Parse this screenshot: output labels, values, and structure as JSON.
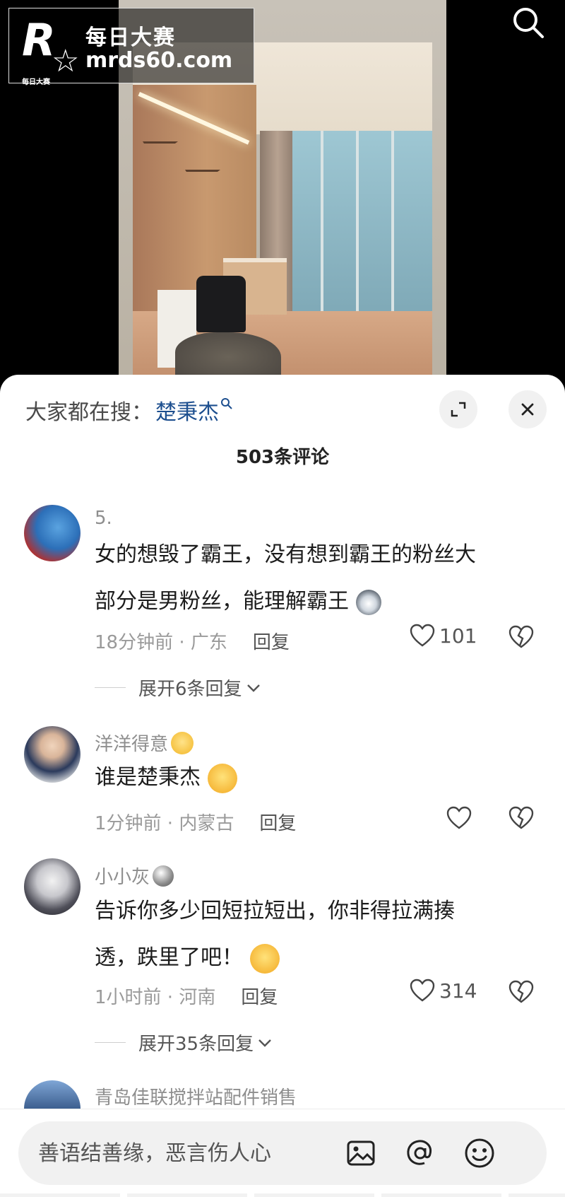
{
  "watermark": {
    "brand": "每日大赛",
    "url": "mrds60.com",
    "mark_letter": "R",
    "mark_mini": "每日大赛"
  },
  "sheet": {
    "hot_search_label": "大家都在搜：",
    "hot_search_term": "楚秉杰",
    "comment_count": "503条评论"
  },
  "comments": [
    {
      "name": "5.",
      "text_line1": "女的想毁了霸王，没有想到霸王的粉丝大",
      "text_line2": "部分是男粉丝，能理解霸王",
      "time_location": "18分钟前 · 广东",
      "reply_label": "回复",
      "likes": "101",
      "expand_label": "展开6条回复"
    },
    {
      "name": "洋洋得意",
      "text_line1": "谁是楚秉杰",
      "time_location": "1分钟前 · 内蒙古",
      "reply_label": "回复",
      "likes": ""
    },
    {
      "name": "小小灰",
      "text_line1": "告诉你多少回短拉短出，你非得拉满揍",
      "text_line2": "透，跌里了吧！",
      "time_location": "1小时前 · 河南",
      "reply_label": "回复",
      "likes": "314",
      "expand_label": "展开35条回复"
    },
    {
      "name": "青岛佳联搅拌站配件销售"
    }
  ],
  "input": {
    "placeholder": "善语结善缘，恶言伤人心"
  },
  "icons": {
    "top_search": "search-icon",
    "expand": "expand-icon",
    "close": "close-icon",
    "like": "heart-icon",
    "dislike": "broken-heart-icon",
    "image": "image-icon",
    "mention": "at-icon",
    "emoji": "emoji-icon"
  },
  "colors": {
    "hot_term": "#1d4f8f",
    "sheet_bg": "#ffffff",
    "input_bg": "#f1f1f1"
  }
}
